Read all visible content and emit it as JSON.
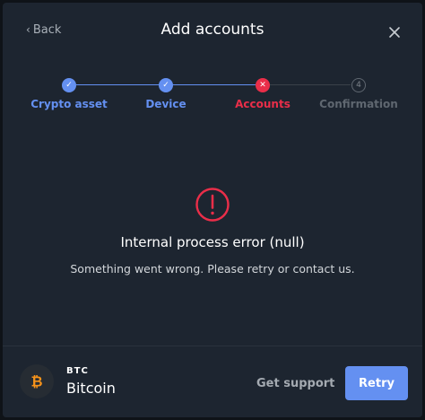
{
  "header": {
    "back_label": "Back",
    "title": "Add accounts"
  },
  "stepper": {
    "steps": [
      {
        "label": "Crypto asset",
        "state": "done",
        "marker": "✓"
      },
      {
        "label": "Device",
        "state": "done",
        "marker": "✓"
      },
      {
        "label": "Accounts",
        "state": "error",
        "marker": "✕"
      },
      {
        "label": "Confirmation",
        "state": "pending",
        "marker": "4"
      }
    ]
  },
  "error": {
    "icon": "exclamation-circle-icon",
    "title": "Internal process error (null)",
    "message": "Something went wrong. Please retry or contact us."
  },
  "footer": {
    "coin_ticker": "BTC",
    "coin_name": "Bitcoin",
    "coin_icon": "bitcoin-icon",
    "support_label": "Get support",
    "retry_label": "Retry"
  },
  "colors": {
    "accent": "#6490f1",
    "error": "#ea2e49",
    "background": "#1d2530",
    "bitcoin": "#f7931a"
  }
}
